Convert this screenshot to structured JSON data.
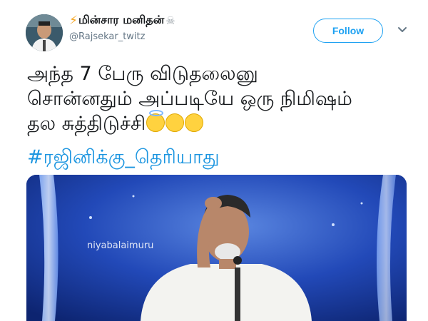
{
  "user": {
    "display_name": "மின்சார மனிதன்",
    "handle": "@Rajsekar_twitz",
    "leading_icon": "lightning-icon",
    "trailing_icon": "skull-crossbones-icon"
  },
  "actions": {
    "follow_label": "Follow",
    "menu_icon": "chevron-down-icon"
  },
  "tweet": {
    "lines": [
      "அந்த 7 பேரு விடுதலைனு",
      "சொன்னதும் அப்படியே ஒரு நிமிஷம்",
      "தல சுத்திடுச்சி"
    ],
    "hashtag": "#ரஜினிக்கு_தெரியாது",
    "emojis": [
      "halo-face-emoji",
      "crying-laughing-emoji",
      "crying-laughing-emoji"
    ]
  },
  "media": {
    "watermark": "niyabalaimuru"
  },
  "colors": {
    "accent": "#1da1f2",
    "hashtag": "#1b95e0",
    "text": "#14171a",
    "secondary": "#657786"
  }
}
